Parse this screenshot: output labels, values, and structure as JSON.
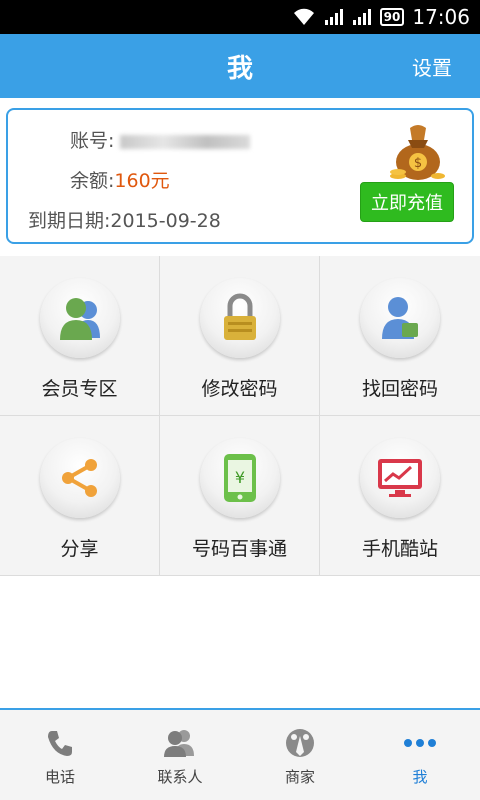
{
  "status_bar": {
    "time": "17:06",
    "battery": "90",
    "icons": [
      "wifi-icon",
      "signal-icon",
      "signal-icon",
      "battery-icon"
    ]
  },
  "header": {
    "title": "我",
    "settings_label": "设置"
  },
  "account": {
    "account_label": "账号:",
    "balance_label": "余额:",
    "balance_value": "160元",
    "expiry_label": "到期日期:",
    "expiry_value": "2015-09-28",
    "recharge_label": "立即充值"
  },
  "grid": {
    "items": [
      {
        "label": "会员专区",
        "icon": "member-icon"
      },
      {
        "label": "修改密码",
        "icon": "padlock-icon"
      },
      {
        "label": "找回密码",
        "icon": "user-recover-icon"
      },
      {
        "label": "分享",
        "icon": "share-icon"
      },
      {
        "label": "号码百事通",
        "icon": "phone-yen-icon"
      },
      {
        "label": "手机酷站",
        "icon": "monitor-chart-icon"
      }
    ]
  },
  "bottom_nav": {
    "items": [
      {
        "label": "电话",
        "icon": "phone-icon"
      },
      {
        "label": "联系人",
        "icon": "contacts-icon"
      },
      {
        "label": "商家",
        "icon": "merchant-icon"
      },
      {
        "label": "我",
        "icon": "more-dots-icon"
      }
    ],
    "active_index": 3
  },
  "colors": {
    "accent": "#3aa0e6",
    "recharge": "#2fbb1f",
    "money": "#e0580e"
  }
}
